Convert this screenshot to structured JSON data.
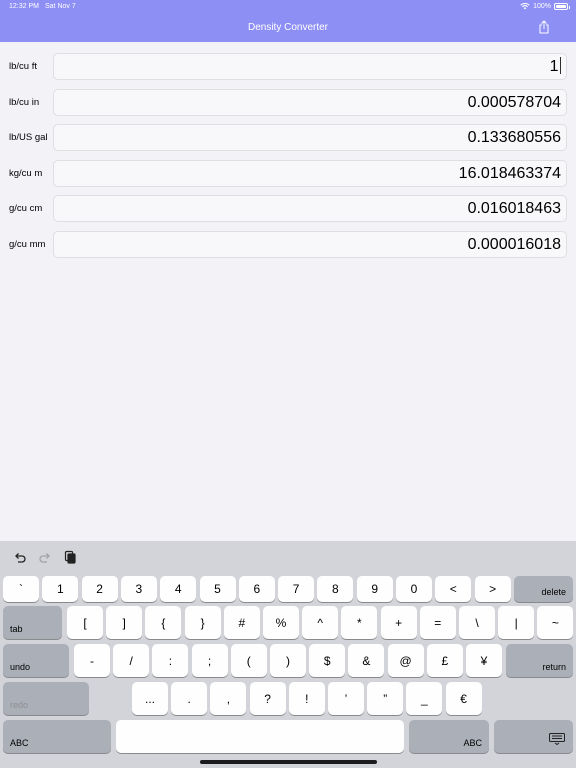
{
  "status": {
    "time": "12:32 PM",
    "date": "Sat Nov 7",
    "battery": "100%"
  },
  "header": {
    "title": "Density Converter",
    "share_icon": "share-icon"
  },
  "rows": [
    {
      "label": "lb/cu ft",
      "value": "1"
    },
    {
      "label": "lb/cu in",
      "value": "0.000578704"
    },
    {
      "label": "lb/US gal",
      "value": "0.133680556"
    },
    {
      "label": "kg/cu m",
      "value": "16.018463374"
    },
    {
      "label": "g/cu cm",
      "value": "0.016018463"
    },
    {
      "label": "g/cu mm",
      "value": "0.000016018"
    }
  ],
  "keyboard": {
    "toolbar": [
      "undo-icon",
      "redo-icon",
      "paste-icon"
    ],
    "row1": [
      "`",
      "1",
      "2",
      "3",
      "4",
      "5",
      "6",
      "7",
      "8",
      "9",
      "0",
      "<",
      ">"
    ],
    "delete_label": "delete",
    "tab_label": "tab",
    "row2": [
      "[",
      "]",
      "{",
      "}",
      "#",
      "%",
      "^",
      "*",
      "+",
      "=",
      "\\",
      "|",
      "~"
    ],
    "undo_label": "undo",
    "row3": [
      "-",
      "/",
      ":",
      ";",
      "(",
      ")",
      "$",
      "&",
      "@",
      "£",
      "¥"
    ],
    "return_label": "return",
    "redo_label": "redo",
    "row4": [
      "...",
      ".",
      ",",
      "?",
      "!",
      "’",
      "”",
      "_",
      "€"
    ],
    "abc_label": "ABC",
    "dismiss_icon": "keyboard-dismiss-icon"
  },
  "colors": {
    "header": "#8e8ff5",
    "background": "#f2f2f7",
    "keyboard": "#d3d4d9",
    "key": "#fefefe",
    "function_key": "#abafb8"
  }
}
